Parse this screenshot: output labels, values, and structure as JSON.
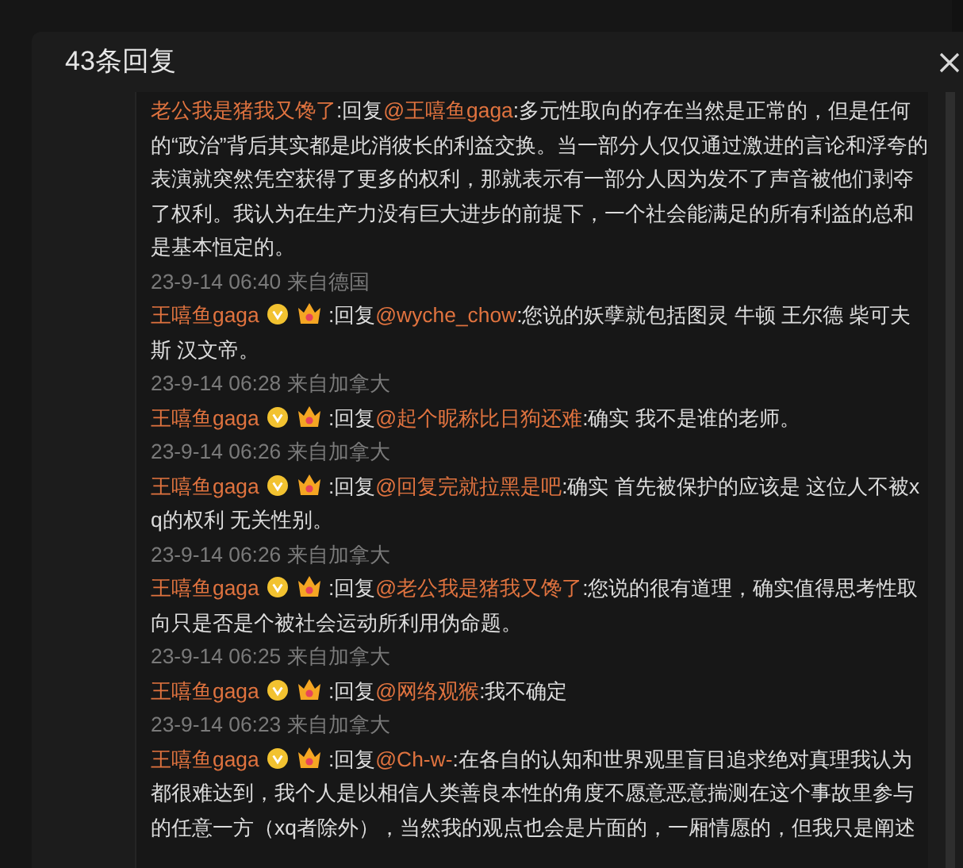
{
  "dialog": {
    "title": "43条回复"
  },
  "comments": [
    {
      "author": "老公我是猪我又馋了",
      "reply_prefix": ":回复",
      "reply_to": "@王嘻鱼gaga",
      "text": ":多元性取向的存在当然是正常的，但是任何的“政治”背后其实都是此消彼长的利益交换。当一部分人仅仅通过激进的言论和浮夸的表演就突然凭空获得了更多的权利，那就表示有一部分人因为发不了声音被他们剥夺了权利。我认为在生产力没有巨大进步的前提下，一个社会能满足的所有利益的总和是基本恒定的。",
      "time": "23-9-14 06:40",
      "location": "来自德国"
    },
    {
      "author": "王嘻鱼gaga",
      "verified": true,
      "vip": true,
      "reply_prefix": " :回复",
      "reply_to": "@wyche_chow",
      "text": ":您说的妖孽就包括图灵 牛顿 王尔德 柴可夫斯 汉文帝。",
      "time": "23-9-14 06:28",
      "location": "来自加拿大"
    },
    {
      "author": "王嘻鱼gaga",
      "verified": true,
      "vip": true,
      "reply_prefix": " :回复",
      "reply_to": "@起个昵称比日狗还难",
      "text": ":确实 我不是谁的老师。",
      "time": "23-9-14 06:26",
      "location": "来自加拿大"
    },
    {
      "author": "王嘻鱼gaga",
      "verified": true,
      "vip": true,
      "reply_prefix": " :回复",
      "reply_to": "@回复完就拉黑是吧",
      "text": ":确实 首先被保护的应该是 这位人不被xq的权利 无关性别。",
      "time": "23-9-14 06:26",
      "location": "来自加拿大"
    },
    {
      "author": "王嘻鱼gaga",
      "verified": true,
      "vip": true,
      "reply_prefix": " :回复",
      "reply_to": "@老公我是猪我又馋了",
      "text": ":您说的很有道理，确实值得思考性取向只是否是个被社会运动所利用伪命题。",
      "time": "23-9-14 06:25",
      "location": "来自加拿大"
    },
    {
      "author": "王嘻鱼gaga",
      "verified": true,
      "vip": true,
      "reply_prefix": " :回复",
      "reply_to": "@网络观猴",
      "text": ":我不确定",
      "time": "23-9-14 06:23",
      "location": "来自加拿大"
    },
    {
      "author": "王嘻鱼gaga",
      "verified": true,
      "vip": true,
      "reply_prefix": " :回复",
      "reply_to": "@Ch-w-",
      "text": ":在各自的认知和世界观里盲目追求绝对真理我认为都很难达到，我个人是以相信人类善良本性的角度不愿意恶意揣测在这个事故里参与的任意一方（xq者除外），当然我的观点也会是片面的，一厢情愿的，但我只是阐述"
    }
  ]
}
